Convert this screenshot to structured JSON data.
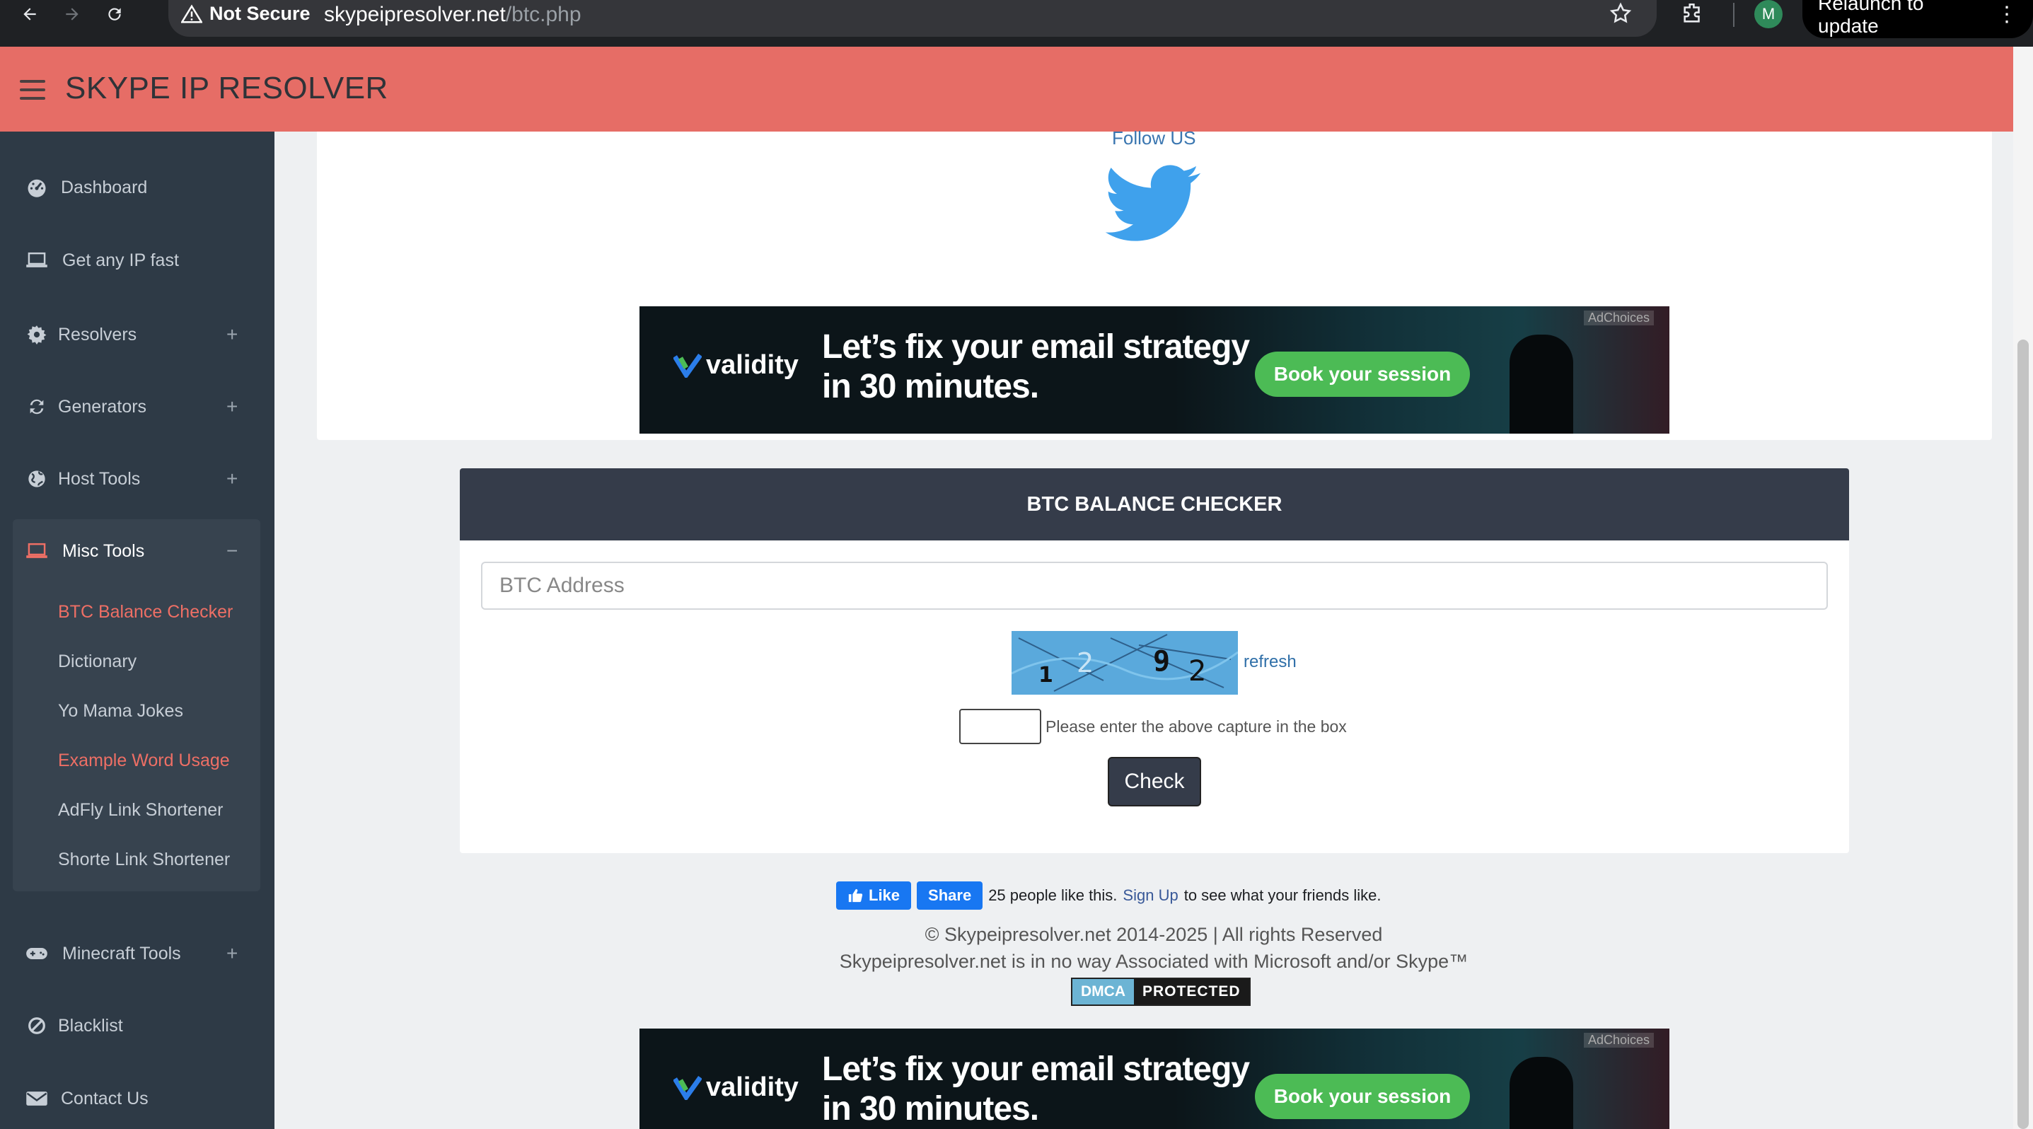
{
  "browser": {
    "security_label": "Not Secure",
    "url_domain": "skypeipresolver.net",
    "url_path": "/btc.php",
    "profile_initial": "M",
    "relaunch_label": "Relaunch to update"
  },
  "header": {
    "title": "SKYPE IP RESOLVER"
  },
  "sidebar": {
    "items": [
      {
        "label": "Dashboard",
        "icon": "dashboard-icon"
      },
      {
        "label": "Get any IP fast",
        "icon": "laptop-icon"
      },
      {
        "label": "Resolvers",
        "icon": "gear-icon",
        "toggle": "+"
      },
      {
        "label": "Generators",
        "icon": "refresh-icon",
        "toggle": "+"
      },
      {
        "label": "Host Tools",
        "icon": "globe-icon",
        "toggle": "+"
      },
      {
        "label": "Misc Tools",
        "icon": "laptop-icon",
        "toggle": "−"
      },
      {
        "label": "Minecraft Tools",
        "icon": "gamepad-icon",
        "toggle": "+"
      },
      {
        "label": "Blacklist",
        "icon": "ban-icon"
      },
      {
        "label": "Contact Us",
        "icon": "envelope-icon"
      }
    ],
    "misc_sub": [
      {
        "label": "BTC Balance Checker",
        "active": true
      },
      {
        "label": "Dictionary"
      },
      {
        "label": "Yo Mama Jokes"
      },
      {
        "label": "Example Word Usage",
        "active": true
      },
      {
        "label": "AdFly Link Shortener"
      },
      {
        "label": "Shorte Link Shortener"
      }
    ]
  },
  "top_card": {
    "follow_label": "Follow US"
  },
  "ad": {
    "brand": "validity",
    "headline": "Let’s fix your email strategy in 30 minutes.",
    "cta": "Book your session",
    "adchoices": "AdChoices"
  },
  "btc": {
    "heading": "BTC BALANCE CHECKER",
    "address_placeholder": "BTC Address",
    "captcha_chars": [
      "1",
      "2",
      "9",
      "2"
    ],
    "refresh_label": "refresh",
    "captcha_hint": "Please enter the above capture in the box",
    "check_label": "Check"
  },
  "footer": {
    "like_label": "Like",
    "share_label": "Share",
    "like_text": "25 people like this.",
    "signup_label": "Sign Up",
    "signup_suffix": "to see what your friends like.",
    "copyright": "© Skypeipresolver.net 2014-2025 | All rights Reserved",
    "disclaimer": "Skypeipresolver.net is in no way Associated with Microsoft and/or Skype™",
    "dmca_left": "DMCA",
    "dmca_right": "PROTECTED"
  },
  "colors": {
    "header_bg": "#e66d66",
    "sidebar_bg": "#2e3a46",
    "active_link": "#ee6f65",
    "card_header": "#353c4a",
    "link": "#3a76b0"
  }
}
